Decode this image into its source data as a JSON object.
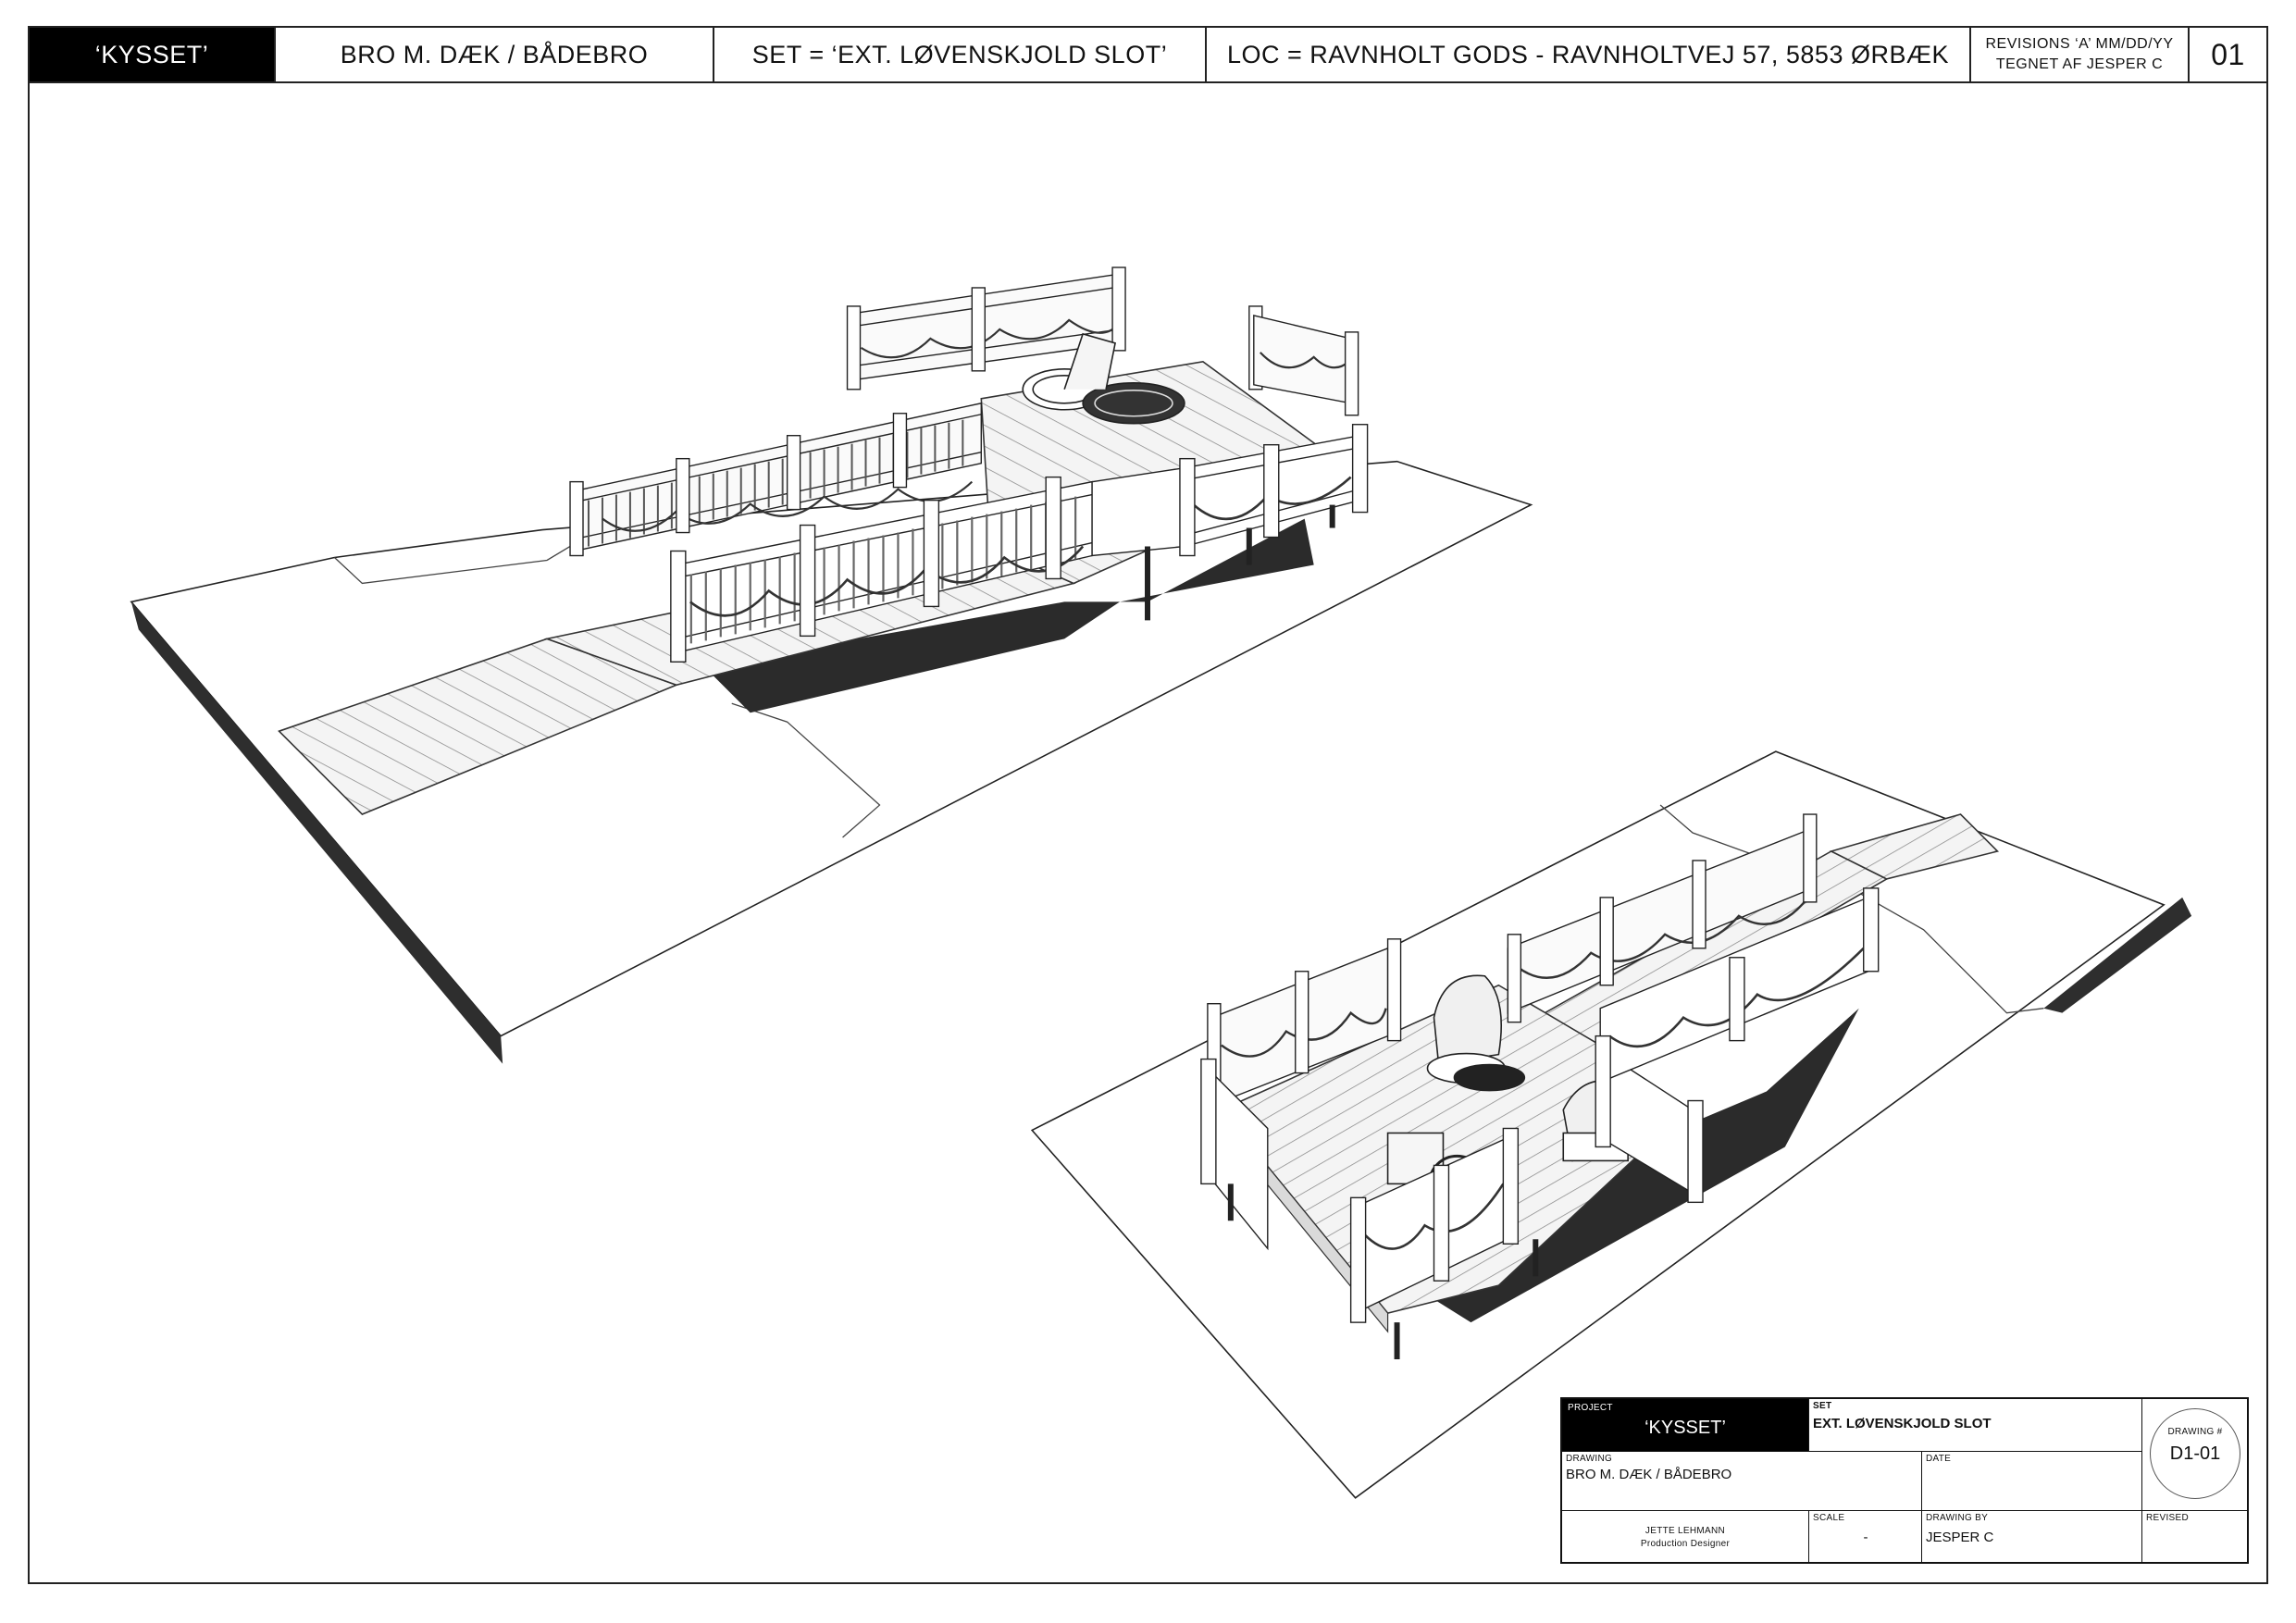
{
  "header": {
    "project": "‘KYSSET’",
    "drawing": "BRO M. DÆK / BÅDEBRO",
    "set": "SET = ‘EXT. LØVENSKJOLD SLOT’",
    "location": "LOC = RAVNHOLT GODS - RAVNHOLTVEJ 57, 5853 ØRBÆK",
    "revisions": "REVISIONS ‘A’ MM/DD/YY",
    "drawn_by": "TEGNET AF JESPER C",
    "sheet_number": "01"
  },
  "title_block": {
    "project_label": "PROJECT",
    "project_value": "‘KYSSET’",
    "set_label": "SET",
    "set_value": "EXT. LØVENSKJOLD SLOT",
    "drawing_no_label": "DRAWING #",
    "drawing_no_value": "D1-01",
    "drawing_label": "DRAWING",
    "drawing_value": "BRO M. DÆK / BÅDEBRO",
    "date_label": "DATE",
    "date_value": "",
    "designer_name": "JETTE LEHMANN",
    "designer_role": "Production Designer",
    "scale_label": "SCALE",
    "scale_value": "-",
    "drawing_by_label": "DRAWING BY",
    "drawing_by_value": "JESPER C",
    "revised_label": "REVISED",
    "revised_value": ""
  },
  "colors": {
    "ink": "#111111",
    "shadow": "#2b2b2b",
    "deck": "#f2f2f2",
    "ground": "#ffffff"
  },
  "views": [
    "view-1-perspective",
    "view-2-perspective"
  ]
}
